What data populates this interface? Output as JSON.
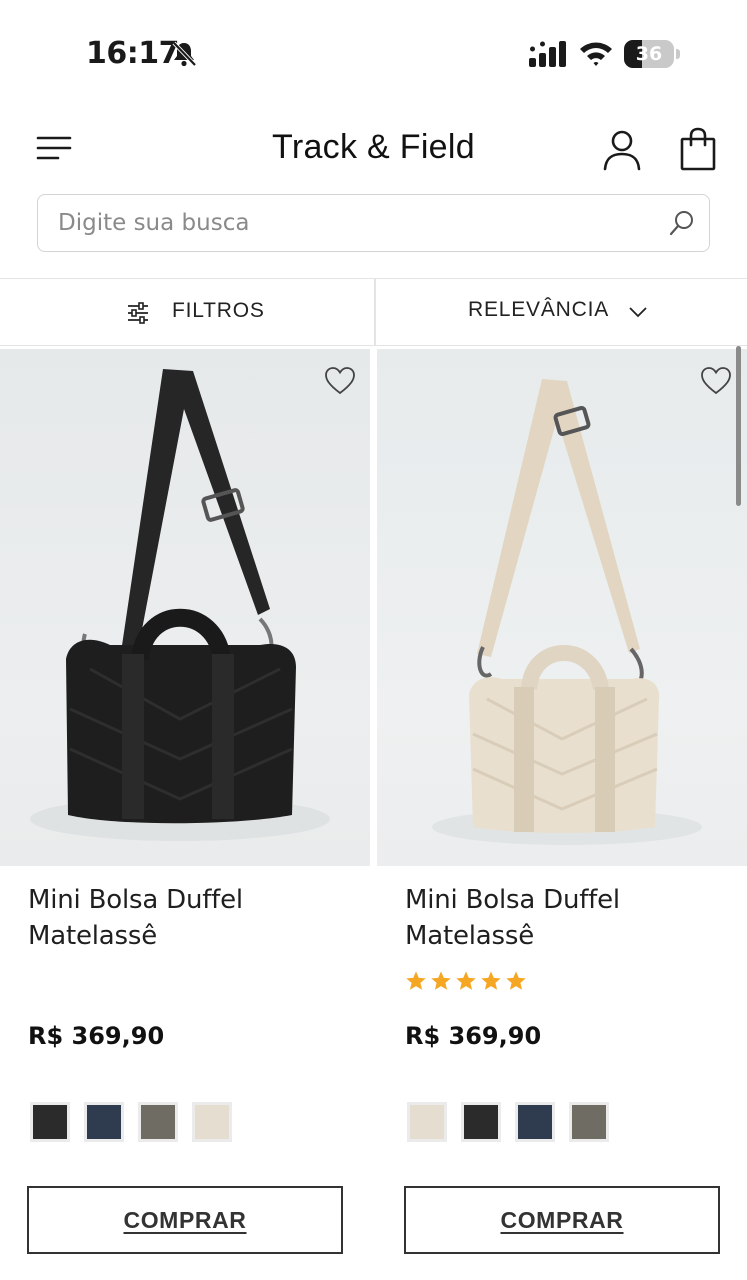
{
  "status_bar": {
    "time": "16:17",
    "battery_level": "36",
    "battery_fraction": 0.36
  },
  "header": {
    "logo": "Track & Field"
  },
  "search": {
    "placeholder": "Digite sua busca"
  },
  "toolbar": {
    "filter_label": "FILTROS",
    "sort_label": "RELEVÂNCIA"
  },
  "products": [
    {
      "title": "Mini Bolsa Duffel Matelassê",
      "price": "R$ 369,90",
      "rating": 0,
      "bag_color": "#1e1e1e",
      "strap_color": "#262626",
      "swatches": [
        "#2b2b2b",
        "#2f3c4f",
        "#6f6d63",
        "#e5ddd0"
      ],
      "button_label": "COMPRAR"
    },
    {
      "title": "Mini Bolsa Duffel Matelassê",
      "price": "R$ 369,90",
      "rating": 5,
      "bag_color": "#e8dfcf",
      "strap_color": "#e2d6c3",
      "swatches": [
        "#e5ddd0",
        "#2b2b2b",
        "#2f3c4f",
        "#6f6d63"
      ],
      "button_label": "COMPRAR"
    }
  ],
  "colors": {
    "star": "#f5a623",
    "border": "#e4e4e4"
  }
}
